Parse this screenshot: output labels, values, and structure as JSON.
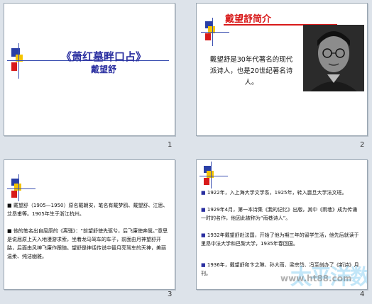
{
  "slides": [
    {
      "number": "1",
      "title": "《萧红墓畔口占》",
      "author": "戴望舒"
    },
    {
      "number": "2",
      "heading": "戴望舒简介",
      "body": "戴望舒是30年代著名的现代派诗人，也是20世纪著名诗人。",
      "photo_alt": "portrait-photo"
    },
    {
      "number": "3",
      "bullets": [
        "戴望舒（1905—1950）原名戴朝安，笔名有戴梦鸥、戴望舒、江思、艾昂甫等。1905年生于浙江杭州。",
        "他的笔名出自屈原的《离骚》：“前望舒使先驱兮，后飞廉使奔属。”意思是说屈原上天入地漫游求索，坐着龙马驾车的车子，前面由月神望舒开路，后面由风神飞廉作跟随。望舒是神话传说中替月亮驾车的天神，美丽温柔、纯洁幽雅。"
      ]
    },
    {
      "number": "4",
      "bullets": [
        "1922年，入上海大学文学系，1925年，转入震旦大学法文班。",
        "1929年4月，第一本诗集《我的记忆》出版，其中《雨巷》成为传诵一时的名作，他因此被称为“雨巷诗人”。",
        "1932年戴望舒赴法国，开始了他为期三年的留学生活，他先后就读于里昂中法大学和巴黎大学，1935年春回国。",
        "1936年，戴望舒和卞之琳、孙大雨、梁宗岱、冯至创办了《新诗》月刊。"
      ],
      "watermark": "太平洋数码网",
      "watermark_url": "www.ht88.com"
    }
  ],
  "colors": {
    "title_blue": "#2a2fa0",
    "heading_red": "#d81a1a",
    "sq_yellow": "#f5c400",
    "sq_red": "#d81a1a",
    "sq_blue": "#2a3fa6",
    "background": "#dde3ea"
  }
}
